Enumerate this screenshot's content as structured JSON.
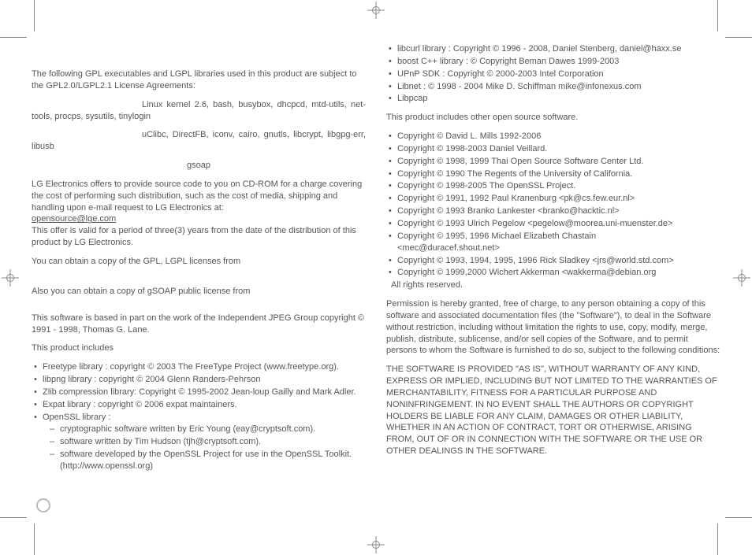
{
  "left": {
    "intro": "The following GPL executables and LGPL libraries used in this product are subject to the GPL2.0/LGPL2.1 License Agreements:",
    "list1": "Linux kernel 2.6, bash, busybox, dhcpcd, mtd-utils, net-tools, procps, sysutils, tinylogin",
    "list2": "uClibc, DirectFB, iconv, cairo, gnutls, libcrypt, libgpg-err, libusb",
    "list3": "gsoap",
    "offer1": "LG Electronics offers to provide source code to you on CD-ROM for a charge covering the cost of performing such distribution, such as the cost of media, shipping and handling upon e-mail request to LG Electronics at:",
    "email": "opensource@lge.com",
    "offer2": "This offer is valid for a period of three(3) years from the date of the distribution of this product by LG Electronics.",
    "gpl": "You can obtain a copy of the GPL, LGPL  licenses from",
    "gsoap": "Also you can obtain a copy of gSOAP  public license from",
    "jpeg": "This software is based in part on the work of the Independent JPEG Group copyright © 1991 - 1998, Thomas G. Lane.",
    "includes": "This product includes",
    "items": [
      "Freetype library : copyright ©  2003 The FreeType Project (www.freetype.org).",
      "libpng library  : copyright ©  2004 Glenn Randers-Pehrson",
      "Zlib compression library: Copyright ©  1995-2002 Jean-loup Gailly and Mark Adler.",
      "Expat library : copyright ©  2006 expat maintainers.",
      "OpenSSL library :"
    ],
    "openssl": [
      "cryptographic software written by Eric Young (eay@cryptsoft.com).",
      "software written by Tim Hudson (tjh@cryptsoft.com).",
      "software developed by the OpenSSL Project for use in the OpenSSL Toolkit. (http://www.openssl.org)"
    ]
  },
  "right": {
    "top": [
      "libcurl library : Copyright ©  1996 - 2008, Daniel Stenberg, daniel@haxx.se",
      "boost C++ library : ©  Copyright Beman Dawes 1999-2003",
      "UPnP SDK : Copyright ©  2000-2003 Intel Corporation",
      "Libnet : © 1998 - 2004 Mike D. Schiffman mike@infonexus.com",
      "Libpcap"
    ],
    "othersHeading": "This product includes other open source software.",
    "others": [
      "Copyright © David L. Mills 1992-2006",
      "Copyright © 1998-2003 Daniel Veillard.",
      "Copyright © 1998, 1999 Thai Open Source Software Center Ltd.",
      "Copyright © 1990 The Regents of the University of California.",
      "Copyright © 1998-2005 The OpenSSL Project.",
      "Copyright © 1991, 1992 Paul Kranenburg <pk@cs.few.eur.nl>",
      "Copyright © 1993 Branko Lankester <branko@hacktic.nl>",
      "Copyright © 1993 Ulrich Pegelow <pegelow@moorea.uni-muenster.de>"
    ],
    "chastain1": "Copyright © 1995, 1996 Michael Elizabeth Chastain",
    "chastain2": "<mec@duracef.shout.net>",
    "others2": [
      "Copyright © 1993, 1994, 1995, 1996 Rick Sladkey <jrs@world.std.com>"
    ],
    "akkerman1": "Copyright © 1999,2000 Wichert Akkerman <wakkerma@debian.org",
    "akkerman2": "All rights reserved.",
    "perm": "Permission is hereby granted, free of charge, to any person obtaining a copy of this software and associated documentation files (the \"Software\"), to deal in the Software without restriction, including without limitation the rights to use, copy, modify, merge, publish, distribute, sublicense, and/or sell copies of the Software, and to permit persons to whom the Software is furnished to do so, subject to the following conditions:",
    "disclaimer": "THE SOFTWARE IS PROVIDED \"AS IS\", WITHOUT  WARRANTY OF ANY KIND, EXPRESS OR IMPLIED, INCLUDING BUT  NOT LIMITED TO THE WARRANTIES OF MERCHANTABILITY, FITNESS FOR A PARTICULAR PURPOSE AND NONINFRINGEMENT.  IN NO EVENT  SHALL THE AUTHORS OR COPYRIGHT  HOLDERS BE LIABLE FOR ANY CLAIM, DAMAGES OR OTHER LIABILITY, WHETHER IN AN ACTION OF CONTRACT, TORT OR OTHERWISE, ARISING FROM, OUT  OF OR IN CONNECTION WITH THE SOFTWARE OR THE USE OR OTHER DEALINGS IN THE SOFTWARE."
  }
}
